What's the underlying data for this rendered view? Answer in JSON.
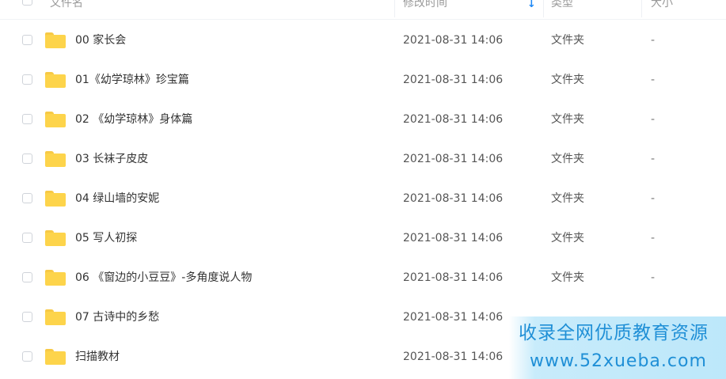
{
  "header": {
    "name_col": "文件名",
    "time_col": "修改时间",
    "type_col": "类型",
    "size_col": "大小",
    "sort_icon": "arrow-down-icon"
  },
  "rows": [
    {
      "name": "00 家长会",
      "time": "2021-08-31 14:06",
      "type": "文件夹",
      "size": "-"
    },
    {
      "name": "01《幼学琼林》珍宝篇",
      "time": "2021-08-31 14:06",
      "type": "文件夹",
      "size": "-"
    },
    {
      "name": "02 《幼学琼林》身体篇",
      "time": "2021-08-31 14:06",
      "type": "文件夹",
      "size": "-"
    },
    {
      "name": "03 长袜子皮皮",
      "time": "2021-08-31 14:06",
      "type": "文件夹",
      "size": "-"
    },
    {
      "name": "04 绿山墙的安妮",
      "time": "2021-08-31 14:06",
      "type": "文件夹",
      "size": "-"
    },
    {
      "name": "05 写人初探",
      "time": "2021-08-31 14:06",
      "type": "文件夹",
      "size": "-"
    },
    {
      "name": "06 《窗边的小豆豆》-多角度说人物",
      "time": "2021-08-31 14:06",
      "type": "文件夹",
      "size": "-"
    },
    {
      "name": "07 古诗中的乡愁",
      "time": "2021-08-31 14:06",
      "type": "",
      "size": ""
    },
    {
      "name": "扫描教材",
      "time": "2021-08-31 14:06",
      "type": "",
      "size": ""
    }
  ],
  "watermark": {
    "line1": "收录全网优质教育资源",
    "line2": "www.52xueba.com"
  },
  "colors": {
    "folder": "#fdd44b",
    "accent": "#1e88f5",
    "watermark_text": "#1f8fd6"
  }
}
